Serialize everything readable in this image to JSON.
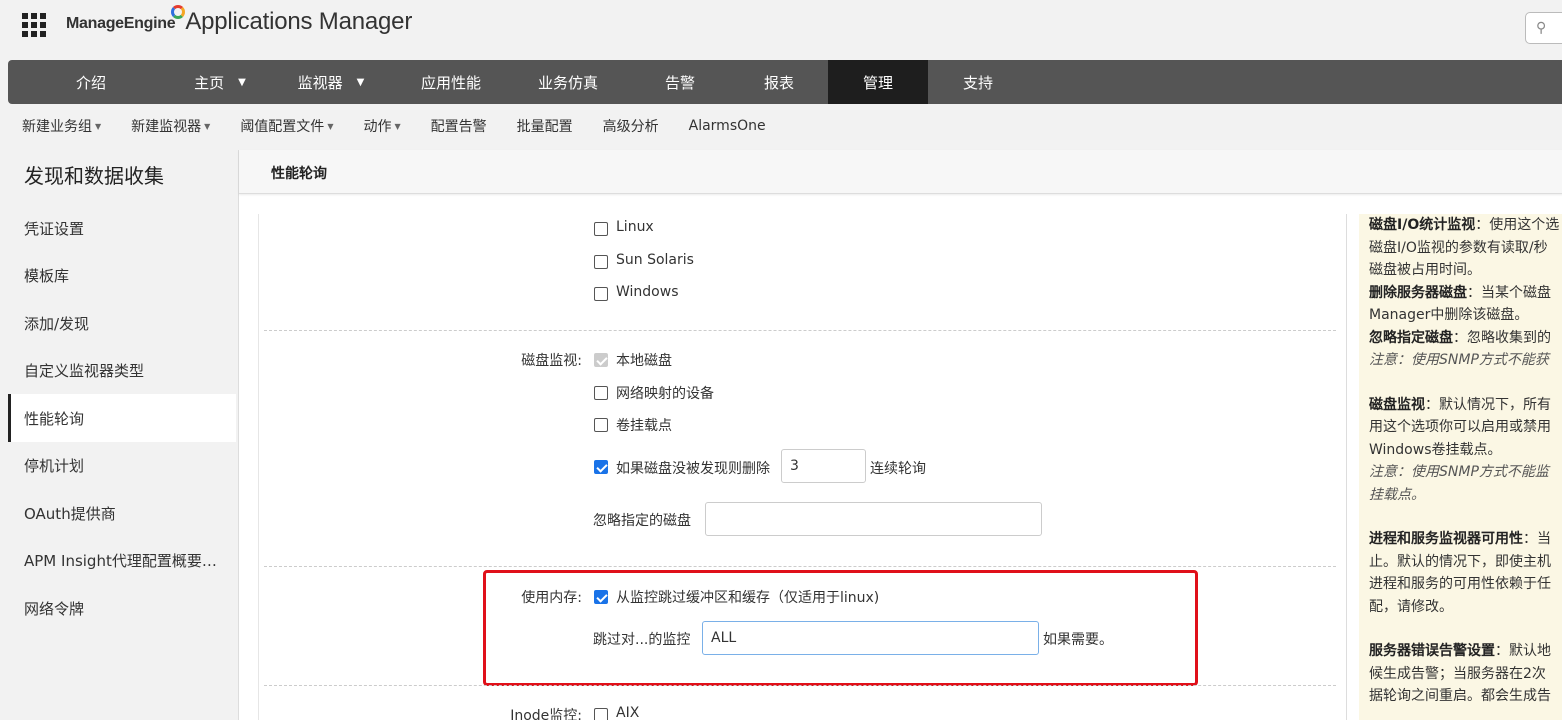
{
  "header": {
    "brand_small": "ManageEngine",
    "brand_large": "Applications Manager"
  },
  "nav": {
    "items": [
      {
        "label": "介绍",
        "dropdown": false
      },
      {
        "label": "主页",
        "dropdown": true
      },
      {
        "label": "监视器",
        "dropdown": true
      },
      {
        "label": "应用性能",
        "dropdown": false
      },
      {
        "label": "业务仿真",
        "dropdown": false
      },
      {
        "label": "告警",
        "dropdown": false
      },
      {
        "label": "报表",
        "dropdown": false
      },
      {
        "label": "管理",
        "dropdown": false,
        "active": true
      },
      {
        "label": "支持",
        "dropdown": false
      }
    ]
  },
  "subnav": {
    "items": [
      "新建业务组",
      "新建监视器",
      "阈值配置文件",
      "动作",
      "配置告警",
      "批量配置",
      "高级分析",
      "AlarmsOne"
    ]
  },
  "sidebar": {
    "title": "发现和数据收集",
    "items": [
      "凭证设置",
      "模板库",
      "添加/发现",
      "自定义监视器类型",
      "性能轮询",
      "停机计划",
      "OAuth提供商",
      "APM Insight代理配置概要…",
      "网络令牌"
    ],
    "active_index": 4
  },
  "panel": {
    "title": "性能轮询"
  },
  "form": {
    "os_options": [
      "Linux",
      "Sun Solaris",
      "Windows"
    ],
    "disk_label": "磁盘监视:",
    "disk_local": "本地磁盘",
    "disk_network": "网络映射的设备",
    "disk_mount": "卷挂载点",
    "disk_delete_prefix": "如果磁盘没被发现则删除",
    "disk_delete_value": "3",
    "disk_delete_suffix": "连续轮询",
    "disk_ignore_label": "忽略指定的磁盘",
    "disk_ignore_value": "",
    "memory_label": "使用内存:",
    "memory_skip": "从监控跳过缓冲区和缓存（仅适用于linux)",
    "memory_skip_for_label": "跳过对...的监控",
    "memory_skip_for_value": "ALL",
    "memory_skip_suffix": "如果需要。",
    "inode_label": "Inode监控:",
    "inode_option": "AIX"
  },
  "help": {
    "lines": [
      {
        "b": "磁盘I/O统计监视",
        "t": "：使用这个选"
      },
      {
        "t": "磁盘I/O监视的参数有读取/秒"
      },
      {
        "t": "磁盘被占用时间。"
      },
      {
        "b": "删除服务器磁盘",
        "t": "：当某个磁盘"
      },
      {
        "t": "Manager中删除该磁盘。"
      },
      {
        "b": "忽略指定磁盘",
        "t": "：忽略收集到的"
      },
      {
        "i": "注意：使用SNMP方式不能获"
      },
      {
        "gap": true
      },
      {
        "b": "磁盘监视",
        "t": "：默认情况下，所有"
      },
      {
        "t": "用这个选项你可以启用或禁用"
      },
      {
        "t": "Windows卷挂载点。"
      },
      {
        "i": "注意：使用SNMP方式不能监"
      },
      {
        "i": "挂载点。"
      },
      {
        "gap": true
      },
      {
        "b": "进程和服务监视器可用性",
        "t": "：当"
      },
      {
        "t": "止。默认的情况下，即使主机"
      },
      {
        "t": "进程和服务的可用性依赖于任"
      },
      {
        "t": "配，请修改。"
      },
      {
        "gap": true
      },
      {
        "b": "服务器错误告警设置",
        "t": "：默认地"
      },
      {
        "t": "候生成告警；当服务器在2次"
      },
      {
        "t": "据轮询之间重启。都会生成告"
      }
    ]
  }
}
